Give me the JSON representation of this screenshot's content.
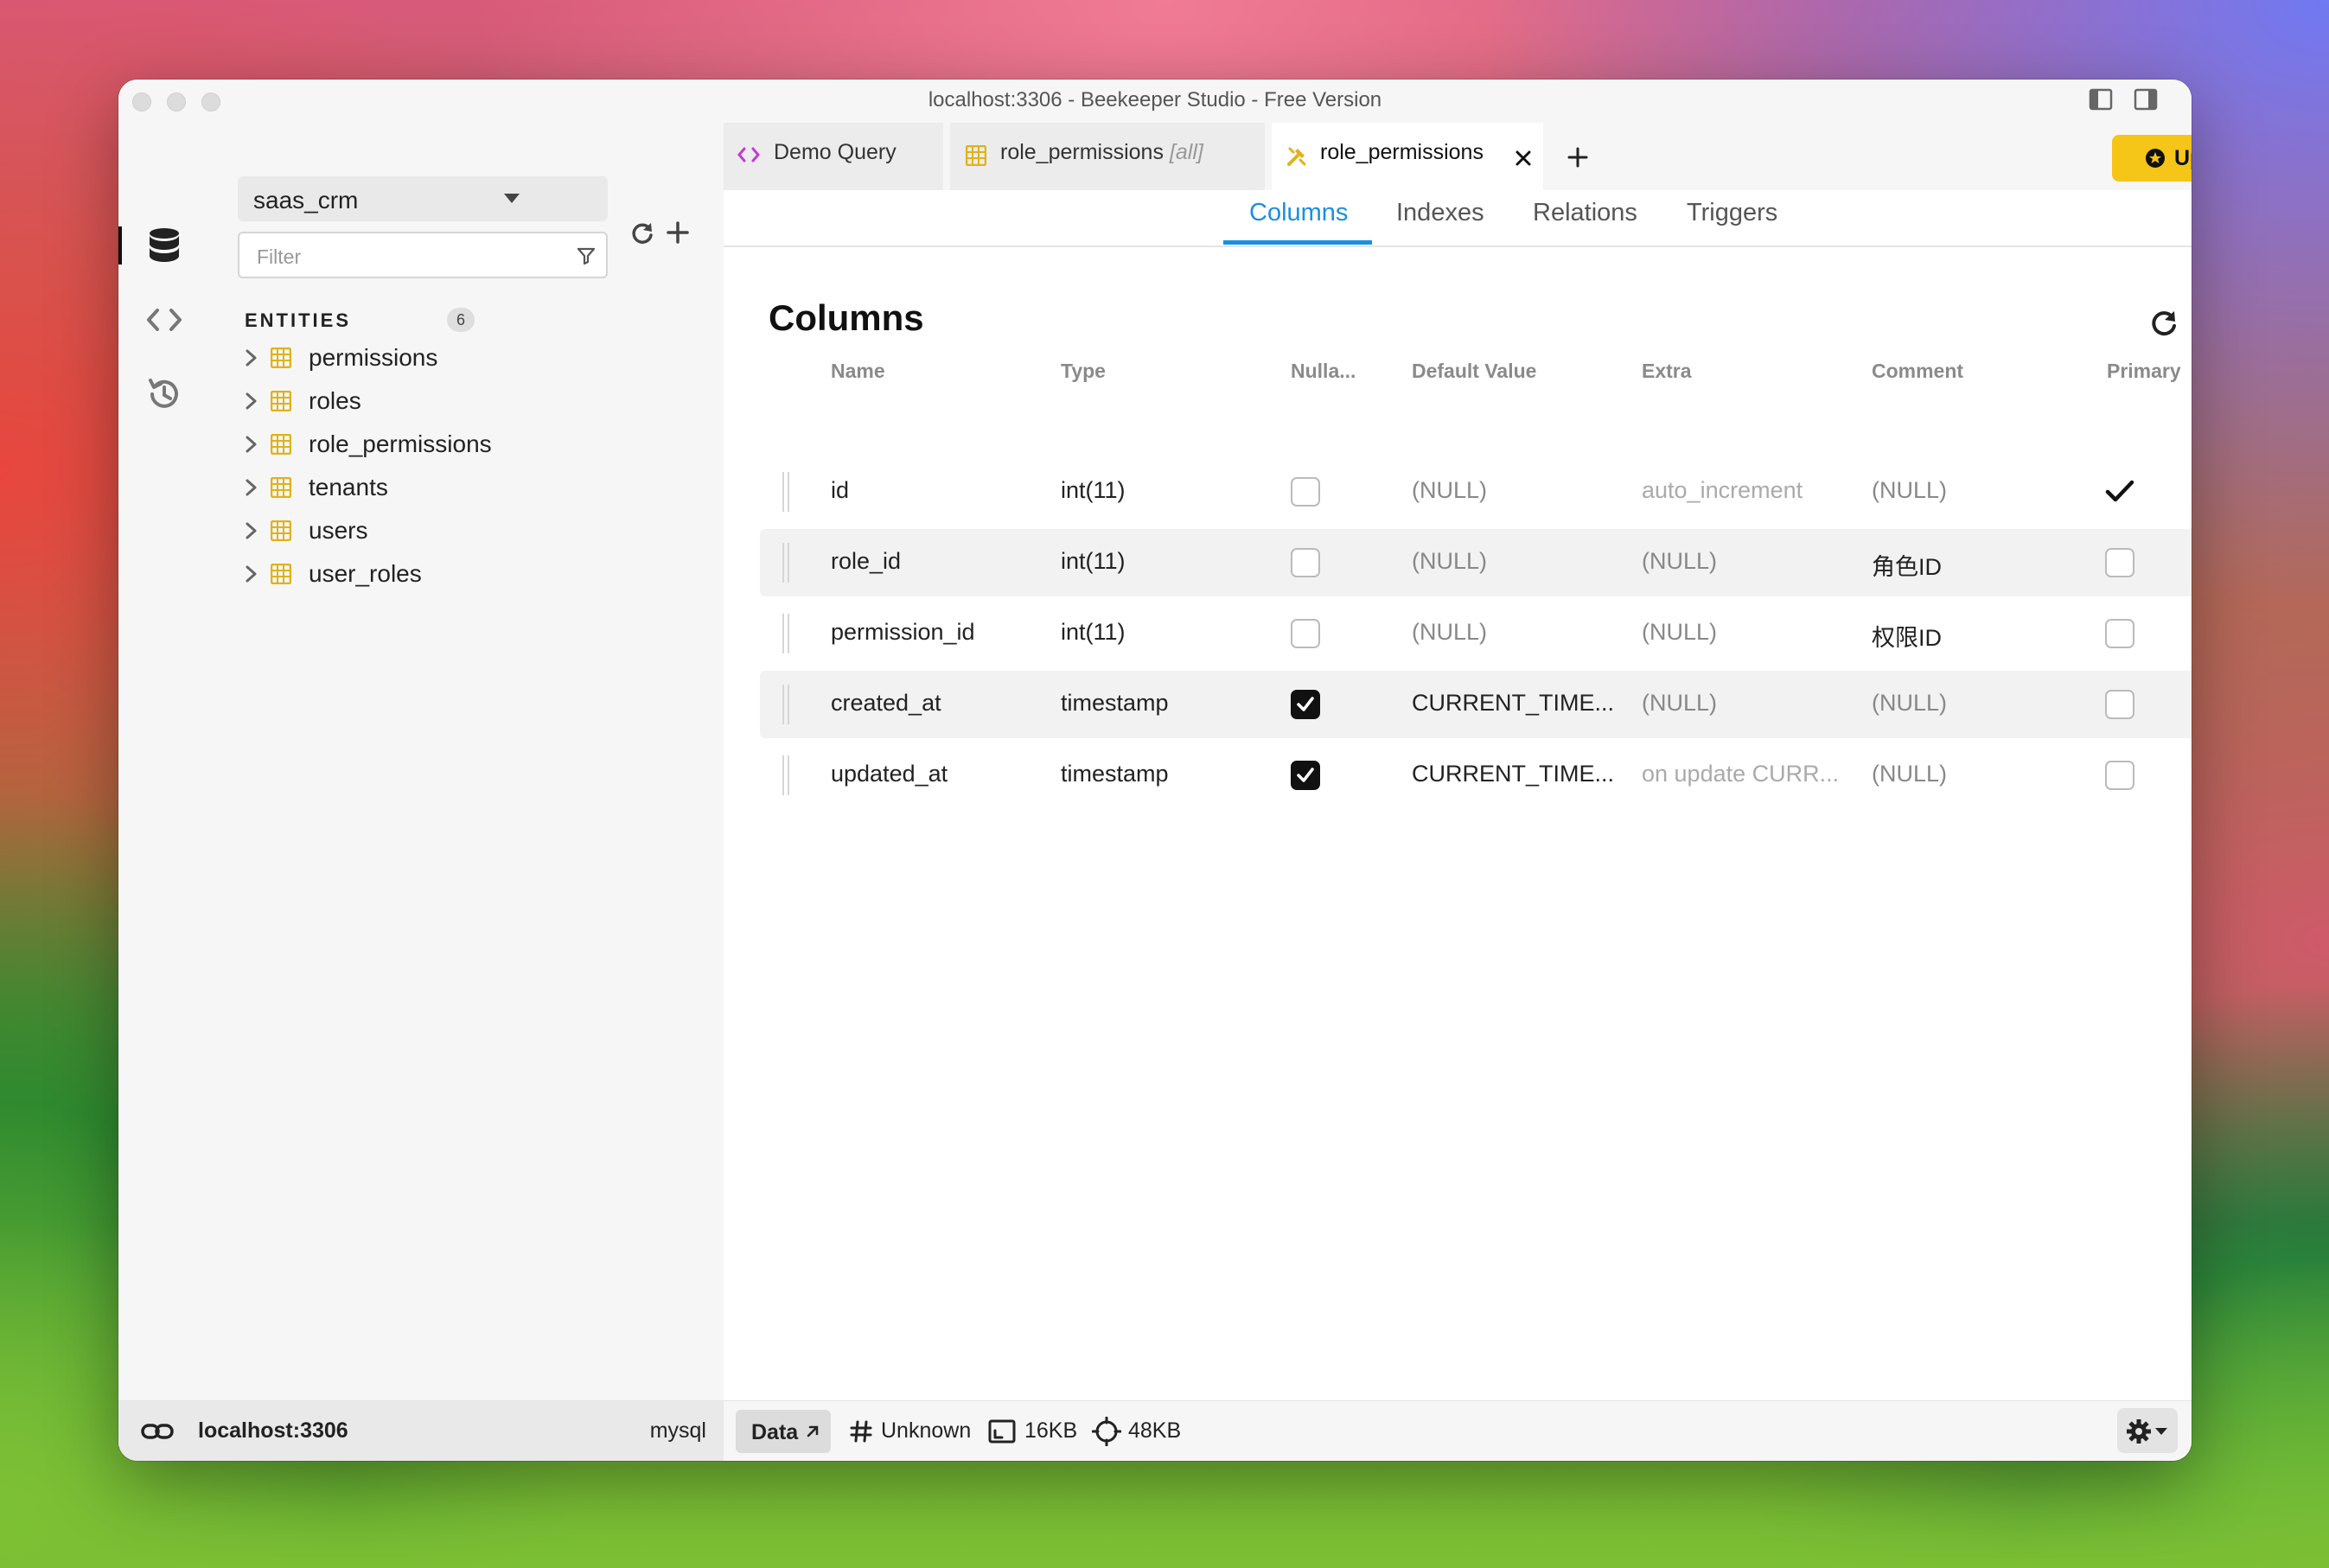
{
  "window": {
    "title": "localhost:3306 - Beekeeper Studio - Free Version"
  },
  "sidebar": {
    "database": "saas_crm",
    "filter_placeholder": "Filter",
    "entities_label": "ENTITIES",
    "entities_count": "6",
    "entities": [
      "permissions",
      "roles",
      "role_permissions",
      "tenants",
      "users",
      "user_roles"
    ]
  },
  "tabs": [
    {
      "label": "Demo Query",
      "icon": "code-icon"
    },
    {
      "label": "role_permissions",
      "sub": "[all]",
      "icon": "table-icon"
    },
    {
      "label": "role_permissions",
      "icon": "structure-tools-icon",
      "active": true
    }
  ],
  "upgrade_label": "Upgrade",
  "subtabs": [
    "Columns",
    "Indexes",
    "Relations",
    "Triggers"
  ],
  "columns_section": {
    "title": "Columns",
    "headers": [
      "Name",
      "Type",
      "Nulla...",
      "Default Value",
      "Extra",
      "Comment",
      "Primary"
    ],
    "rows": [
      {
        "name": "id",
        "type": "int(11)",
        "nullable": false,
        "default": "(NULL)",
        "extra": "auto_increment",
        "comment": "(NULL)",
        "primary": true
      },
      {
        "name": "role_id",
        "type": "int(11)",
        "nullable": false,
        "default": "(NULL)",
        "extra": "(NULL)",
        "comment": "角色ID",
        "primary": false
      },
      {
        "name": "permission_id",
        "type": "int(11)",
        "nullable": false,
        "default": "(NULL)",
        "extra": "(NULL)",
        "comment": "权限ID",
        "primary": false
      },
      {
        "name": "created_at",
        "type": "timestamp",
        "nullable": true,
        "default": "CURRENT_TIME...",
        "extra": "(NULL)",
        "comment": "(NULL)",
        "primary": false
      },
      {
        "name": "updated_at",
        "type": "timestamp",
        "nullable": true,
        "default": "CURRENT_TIME...",
        "extra": "on update CURR...",
        "comment": "(NULL)",
        "primary": false
      }
    ]
  },
  "statusbar": {
    "connection": "localhost:3306",
    "driver": "mysql",
    "data_label": "Data",
    "row_count": "Unknown",
    "table_size": "16KB",
    "index_size": "48KB"
  },
  "colors": {
    "accent": "#1a8fe0",
    "upgrade": "#f5c518",
    "table_icon": "#e0b21a"
  }
}
